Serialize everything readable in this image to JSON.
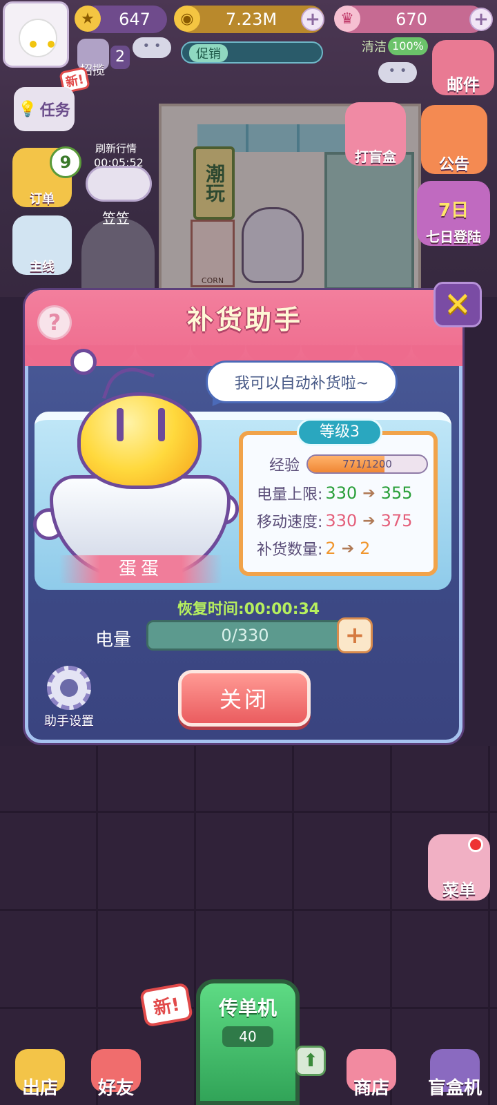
{
  "topbar": {
    "stars": "647",
    "coins": "7.23M",
    "gems": "670",
    "promo_label": "促销",
    "invite_label": "招揽",
    "invite_count": "2",
    "clean_label": "清洁",
    "clean_percent": "100%",
    "new_badge": "新!"
  },
  "left_menu": {
    "task": "任务",
    "order": "订单",
    "order_count": "9",
    "main": "主线",
    "refresh_label": "刷新行情",
    "refresh_time": "00:05:52",
    "npc_name": "笠笠"
  },
  "right_menu": {
    "mail": "邮件",
    "blindbox_open": "打盲盒",
    "announcement": "公告",
    "seven_day": "七日登陆",
    "seven_day_icon": "7日",
    "menu": "菜单"
  },
  "shop": {
    "sign": "潮玩",
    "corn_sign": "CORN"
  },
  "modal": {
    "title": "补货助手",
    "speech": "我可以自动补货啦~",
    "pet_name": "蛋蛋",
    "level": "等级3",
    "exp_label": "经验",
    "exp_text": "771/1200",
    "exp_fraction": 0.6425,
    "power_cap_label": "电量上限:",
    "power_cap_from": "330",
    "power_cap_to": "355",
    "speed_label": "移动速度:",
    "speed_from": "330",
    "speed_to": "375",
    "restock_label": "补货数量:",
    "restock_from": "2",
    "restock_to": "2",
    "arrow": "➔",
    "recovery": "恢复时间:00:00:34",
    "power_label": "电量",
    "power_text": "0/330",
    "power_fraction": 0,
    "close_button": "关闭",
    "settings": "助手设置",
    "help": "?",
    "close_x": "✕"
  },
  "bottom_nav": {
    "out_shop": "出店",
    "friends": "好友",
    "flyer": "传单机",
    "flyer_count": "40",
    "new_badge": "新!",
    "store": "商店",
    "blindbox_machine": "盲盒机"
  }
}
